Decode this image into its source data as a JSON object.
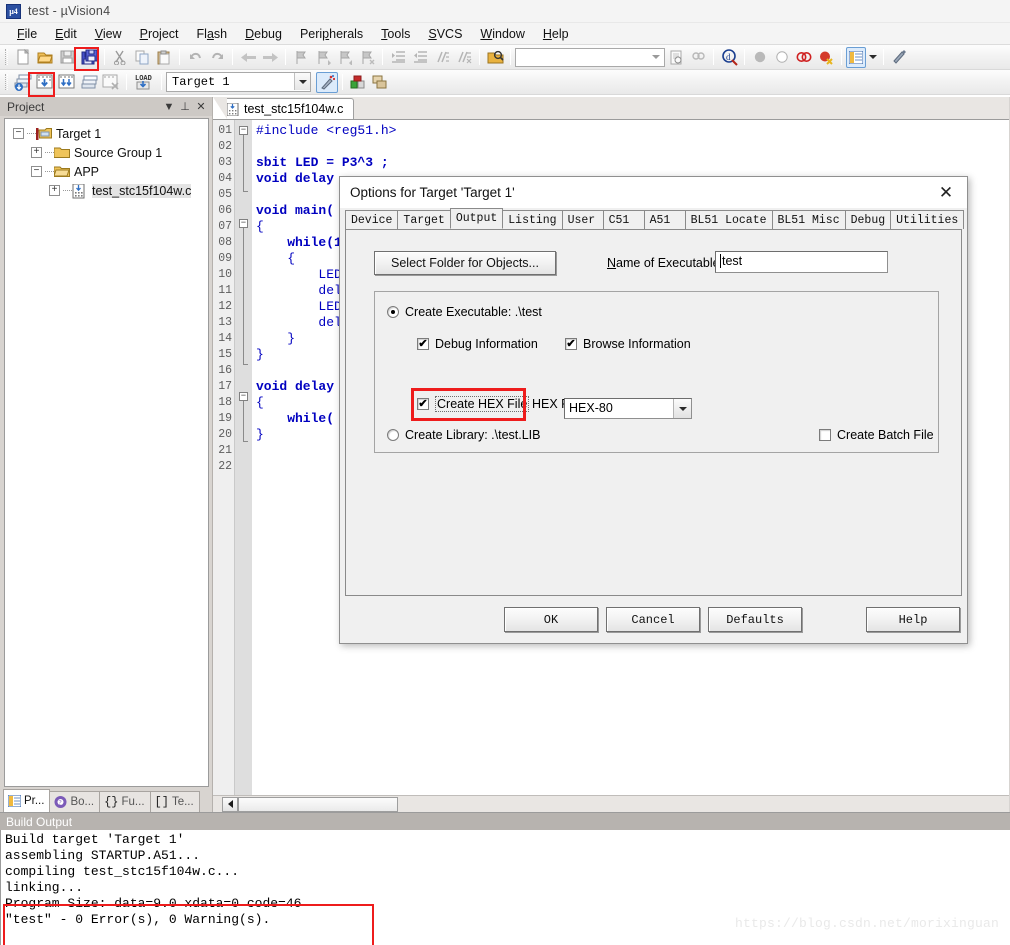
{
  "titlebar": {
    "icon": "uvision-icon",
    "text": "test  - µVision4"
  },
  "menubar": {
    "items": [
      {
        "label": "File"
      },
      {
        "label": "Edit"
      },
      {
        "label": "View"
      },
      {
        "label": "Project"
      },
      {
        "label": "Flash"
      },
      {
        "label": "Debug"
      },
      {
        "label": "Peripherals"
      },
      {
        "label": "Tools"
      },
      {
        "label": "SVCS"
      },
      {
        "label": "Window"
      },
      {
        "label": "Help"
      }
    ]
  },
  "toolbar2": {
    "target_combo_value": "Target 1",
    "search_value": ""
  },
  "project_panel": {
    "header_title": "Project",
    "tree": [
      {
        "label": "Target 1",
        "expander": "-",
        "icon": "target-icon",
        "depth": 0
      },
      {
        "label": "Source Group 1",
        "expander": "+",
        "icon": "folder-icon",
        "depth": 1
      },
      {
        "label": "APP",
        "expander": "-",
        "icon": "folder-open-icon",
        "depth": 1
      },
      {
        "label": "test_stc15f104w.c",
        "expander": "+",
        "icon": "c-file-icon",
        "depth": 2
      }
    ],
    "tabs": [
      {
        "label": "Pr...",
        "icon": "project-icon",
        "active": true
      },
      {
        "label": "Bo...",
        "icon": "books-icon",
        "active": false
      },
      {
        "label": "Fu...",
        "icon": "functions-icon",
        "active": false
      },
      {
        "label": "Te...",
        "icon": "templates-icon",
        "active": false
      }
    ]
  },
  "editor": {
    "tab_label": "test_stc15f104w.c",
    "lines": [
      {
        "num": "01",
        "text": "#include <reg51.h>",
        "fold": "box-open"
      },
      {
        "num": "02",
        "text": "",
        "fold": "stem"
      },
      {
        "num": "03",
        "text": "sbit LED = P3^3 ;",
        "fold": "stem"
      },
      {
        "num": "04",
        "text": "void delay",
        "fold": "stem"
      },
      {
        "num": "05",
        "text": "",
        "fold": "end"
      },
      {
        "num": "06",
        "text": "void main(",
        "fold": ""
      },
      {
        "num": "07",
        "text": "{",
        "fold": "box-open"
      },
      {
        "num": "08",
        "text": "    while(1",
        "fold": "stem"
      },
      {
        "num": "09",
        "text": "    {",
        "fold": "stem"
      },
      {
        "num": "10",
        "text": "        LED",
        "fold": "stem"
      },
      {
        "num": "11",
        "text": "        del",
        "fold": "stem"
      },
      {
        "num": "12",
        "text": "        LED",
        "fold": "stem"
      },
      {
        "num": "13",
        "text": "        del",
        "fold": "stem"
      },
      {
        "num": "14",
        "text": "    }",
        "fold": "stem"
      },
      {
        "num": "15",
        "text": "}",
        "fold": "stem"
      },
      {
        "num": "16",
        "text": "",
        "fold": "end"
      },
      {
        "num": "17",
        "text": "void delay",
        "fold": ""
      },
      {
        "num": "18",
        "text": "{",
        "fold": "box-open"
      },
      {
        "num": "19",
        "text": "    while(",
        "fold": "stem"
      },
      {
        "num": "20",
        "text": "}",
        "fold": "stem"
      },
      {
        "num": "21",
        "text": "",
        "fold": "end"
      },
      {
        "num": "22",
        "text": "",
        "fold": ""
      }
    ]
  },
  "dialog": {
    "title": "Options for Target 'Target 1'",
    "close_icon": "close-icon",
    "tabs": [
      {
        "label": "Device",
        "active": false
      },
      {
        "label": "Target",
        "active": false
      },
      {
        "label": "Output",
        "active": true
      },
      {
        "label": "Listing",
        "active": false
      },
      {
        "label": "User",
        "active": false
      },
      {
        "label": "C51",
        "active": false
      },
      {
        "label": "A51",
        "active": false
      },
      {
        "label": "BL51 Locate",
        "active": false
      },
      {
        "label": "BL51 Misc",
        "active": false
      },
      {
        "label": "Debug",
        "active": false
      },
      {
        "label": "Utilities",
        "active": false
      }
    ],
    "select_folder_button": "Select Folder for Objects...",
    "name_of_executable_label": "Name of Executable:",
    "name_of_executable_value": "test",
    "create_executable_label": "Create Executable:  .\\test",
    "create_executable_checked": true,
    "debug_information_label": "Debug Information",
    "debug_information_checked": true,
    "browse_information_label": "Browse Information",
    "browse_information_checked": true,
    "create_hex_file_label": "Create HEX File",
    "create_hex_file_checked": true,
    "hex_format_label": "HEX Format:",
    "hex_format_value": "HEX-80",
    "create_library_label": "Create Library:  .\\test.LIB",
    "create_library_checked": false,
    "create_batch_file_label": "Create Batch File",
    "create_batch_file_checked": false,
    "buttons": [
      {
        "label": "OK"
      },
      {
        "label": "Cancel"
      },
      {
        "label": "Defaults"
      },
      {
        "label": "Help"
      }
    ]
  },
  "build_output": {
    "header": "Build Output",
    "lines": [
      "Build target 'Target 1'",
      "assembling STARTUP.A51...",
      "compiling test_stc15f104w.c...",
      "linking...",
      "Program Size: data=9.0 xdata=0 code=46",
      "\"test\" - 0 Error(s), 0 Warning(s)."
    ]
  },
  "watermark": "https://blog.csdn.net/morixinguan",
  "colors": {
    "highlight_red": "#ee1c1c",
    "keyword_blue": "#0000c0",
    "title_gray": "#4a4a4a"
  }
}
